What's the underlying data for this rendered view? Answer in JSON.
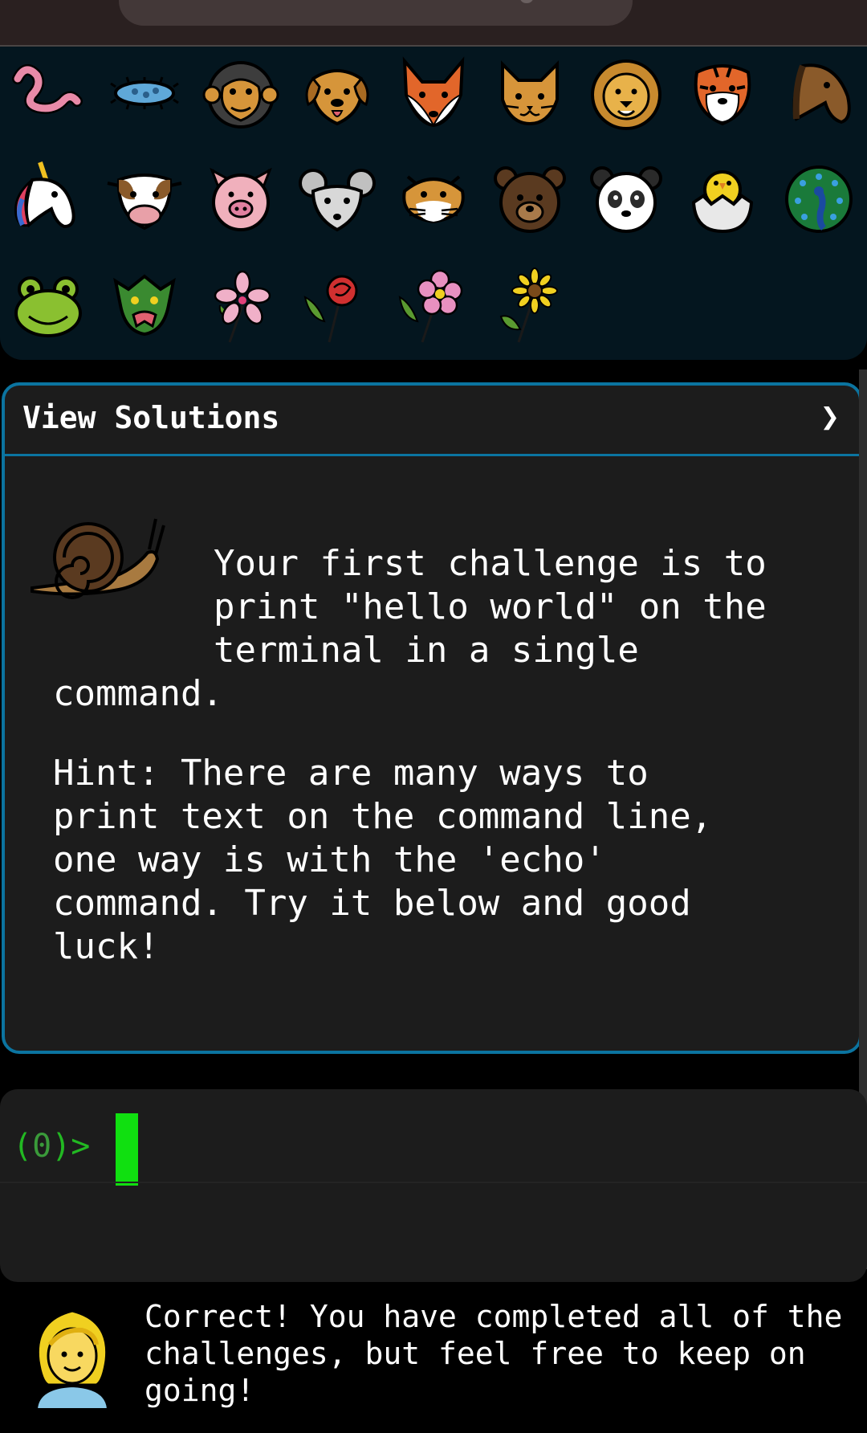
{
  "emoji_grid": {
    "rows": [
      [
        "worm-icon",
        "microbe-icon",
        "monkey-face-icon",
        "dog-face-icon",
        "fox-face-icon",
        "cat-face-icon",
        "lion-face-icon",
        "tiger-face-icon",
        "horse-face-icon"
      ],
      [
        "unicorn-face-icon",
        "cow-face-icon",
        "pig-face-icon",
        "mouse-face-icon",
        "hamster-face-icon",
        "bear-face-icon",
        "panda-face-icon",
        "hatching-chick-icon",
        "peacock-icon"
      ],
      [
        "frog-face-icon",
        "dragon-face-icon",
        "cherry-blossom-icon",
        "rose-icon",
        "hibiscus-icon",
        "sunflower-icon"
      ]
    ]
  },
  "solutions": {
    "title": "View Solutions",
    "chevron": "❯",
    "icon": "snail-icon",
    "challenge_line1": "Your first challenge is to",
    "challenge_line2": "print \"hello world\" on the",
    "challenge_line3": "terminal in a single",
    "challenge_line4": "command.",
    "hint_line1": "Hint: There are many ways to",
    "hint_line2": "print text on the command line,",
    "hint_line3": "one way is with the 'echo'",
    "hint_line4": "command. Try it below and good",
    "hint_line5": "luck!"
  },
  "terminal": {
    "prompt_open": "(",
    "prompt_num": "0",
    "prompt_close": ")>",
    "cursor_color": "#10e010"
  },
  "footer": {
    "icon": "woman-icon",
    "message_line1": "Correct! You have completed all of the",
    "message_line2": "challenges, but feel free to keep on",
    "message_line3": "going!"
  },
  "colors": {
    "accent": "#0b74a0",
    "prompt_green": "#22b822"
  }
}
